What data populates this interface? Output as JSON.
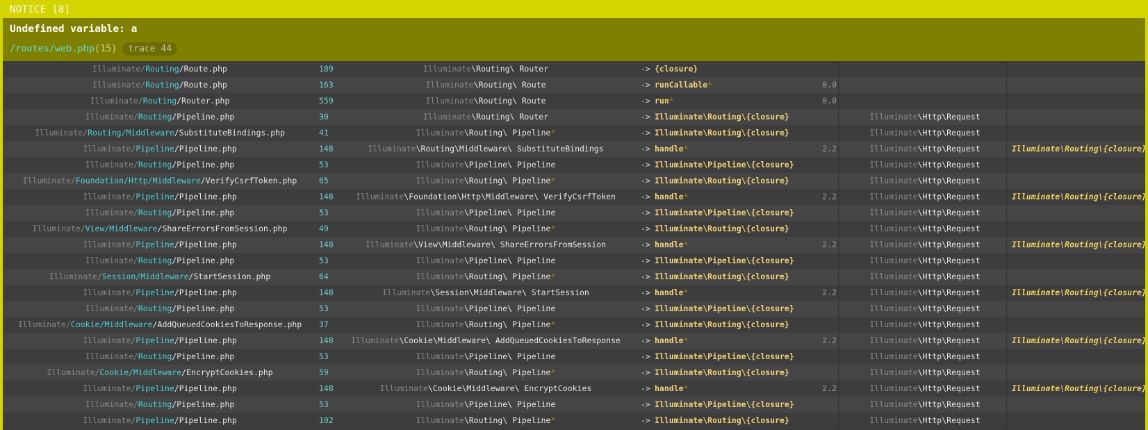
{
  "header": {
    "notice": "NOTICE [8]",
    "message": "Undefined variable: a",
    "file": "/routes/web.php",
    "line": "(15)",
    "trace_badge": "trace 44"
  },
  "rows": [
    {
      "fv": "Illuminate/",
      "fm": "Routing",
      "fe": "/Route.php",
      "line": "189",
      "cv": "Illuminate",
      "cw": "\\Routing\\ Router",
      "cs": "",
      "func": "{closure}",
      "fs": "",
      "time": "",
      "rv": "",
      "rw": "",
      "ret": ""
    },
    {
      "fv": "Illuminate/",
      "fm": "Routing",
      "fe": "/Route.php",
      "line": "163",
      "cv": "Illuminate",
      "cw": "\\Routing\\ Route",
      "cs": "",
      "func": "runCallable",
      "fs": "*",
      "time": "0.0",
      "rv": "",
      "rw": "",
      "ret": ""
    },
    {
      "fv": "Illuminate/",
      "fm": "Routing",
      "fe": "/Router.php",
      "line": "559",
      "cv": "Illuminate",
      "cw": "\\Routing\\ Route",
      "cs": "",
      "func": "run",
      "fs": "*",
      "time": "0.0",
      "rv": "",
      "rw": "",
      "ret": ""
    },
    {
      "fv": "Illuminate/",
      "fm": "Routing",
      "fe": "/Pipeline.php",
      "line": "30",
      "cv": "Illuminate",
      "cw": "\\Routing\\ Router",
      "cs": "",
      "func": "Illuminate\\Routing\\{closure}",
      "fs": "",
      "time": "",
      "rv": "Illuminate",
      "rw": "\\Http\\Request",
      "ret": ""
    },
    {
      "fv": "Illuminate/",
      "fm": "Routing/Middleware",
      "fe": "/SubstituteBindings.php",
      "line": "41",
      "cv": "Illuminate",
      "cw": "\\Routing\\ Pipeline",
      "cs": "*",
      "func": "Illuminate\\Routing\\{closure}",
      "fs": "",
      "time": "",
      "rv": "Illuminate",
      "rw": "\\Http\\Request",
      "ret": ""
    },
    {
      "fv": "Illuminate/",
      "fm": "Pipeline",
      "fe": "/Pipeline.php",
      "line": "148",
      "cv": "Illuminate",
      "cw": "\\Routing\\Middleware\\ SubstituteBindings",
      "cs": "",
      "func": "handle",
      "fs": "*",
      "time": "2.2",
      "rv": "Illuminate",
      "rw": "\\Http\\Request",
      "ret": "Illuminate\\Routing\\{closure}"
    },
    {
      "fv": "Illuminate/",
      "fm": "Routing",
      "fe": "/Pipeline.php",
      "line": "53",
      "cv": "Illuminate",
      "cw": "\\Pipeline\\ Pipeline",
      "cs": "",
      "func": "Illuminate\\Pipeline\\{closure}",
      "fs": "",
      "time": "",
      "rv": "Illuminate",
      "rw": "\\Http\\Request",
      "ret": ""
    },
    {
      "fv": "Illuminate/",
      "fm": "Foundation/Http/Middleware",
      "fe": "/VerifyCsrfToken.php",
      "line": "65",
      "cv": "Illuminate",
      "cw": "\\Routing\\ Pipeline",
      "cs": "*",
      "func": "Illuminate\\Routing\\{closure}",
      "fs": "",
      "time": "",
      "rv": "Illuminate",
      "rw": "\\Http\\Request",
      "ret": ""
    },
    {
      "fv": "Illuminate/",
      "fm": "Pipeline",
      "fe": "/Pipeline.php",
      "line": "148",
      "cv": "Illuminate",
      "cw": "\\Foundation\\Http\\Middleware\\ VerifyCsrfToken",
      "cs": "",
      "func": "handle",
      "fs": "*",
      "time": "2.2",
      "rv": "Illuminate",
      "rw": "\\Http\\Request",
      "ret": "Illuminate\\Routing\\{closure}"
    },
    {
      "fv": "Illuminate/",
      "fm": "Routing",
      "fe": "/Pipeline.php",
      "line": "53",
      "cv": "Illuminate",
      "cw": "\\Pipeline\\ Pipeline",
      "cs": "",
      "func": "Illuminate\\Pipeline\\{closure}",
      "fs": "",
      "time": "",
      "rv": "Illuminate",
      "rw": "\\Http\\Request",
      "ret": ""
    },
    {
      "fv": "Illuminate/",
      "fm": "View/Middleware",
      "fe": "/ShareErrorsFromSession.php",
      "line": "49",
      "cv": "Illuminate",
      "cw": "\\Routing\\ Pipeline",
      "cs": "*",
      "func": "Illuminate\\Routing\\{closure}",
      "fs": "",
      "time": "",
      "rv": "Illuminate",
      "rw": "\\Http\\Request",
      "ret": ""
    },
    {
      "fv": "Illuminate/",
      "fm": "Pipeline",
      "fe": "/Pipeline.php",
      "line": "148",
      "cv": "Illuminate",
      "cw": "\\View\\Middleware\\ ShareErrorsFromSession",
      "cs": "",
      "func": "handle",
      "fs": "*",
      "time": "2.2",
      "rv": "Illuminate",
      "rw": "\\Http\\Request",
      "ret": "Illuminate\\Routing\\{closure}"
    },
    {
      "fv": "Illuminate/",
      "fm": "Routing",
      "fe": "/Pipeline.php",
      "line": "53",
      "cv": "Illuminate",
      "cw": "\\Pipeline\\ Pipeline",
      "cs": "",
      "func": "Illuminate\\Pipeline\\{closure}",
      "fs": "",
      "time": "",
      "rv": "Illuminate",
      "rw": "\\Http\\Request",
      "ret": ""
    },
    {
      "fv": "Illuminate/",
      "fm": "Session/Middleware",
      "fe": "/StartSession.php",
      "line": "64",
      "cv": "Illuminate",
      "cw": "\\Routing\\ Pipeline",
      "cs": "*",
      "func": "Illuminate\\Routing\\{closure}",
      "fs": "",
      "time": "",
      "rv": "Illuminate",
      "rw": "\\Http\\Request",
      "ret": ""
    },
    {
      "fv": "Illuminate/",
      "fm": "Pipeline",
      "fe": "/Pipeline.php",
      "line": "148",
      "cv": "Illuminate",
      "cw": "\\Session\\Middleware\\ StartSession",
      "cs": "",
      "func": "handle",
      "fs": "*",
      "time": "2.2",
      "rv": "Illuminate",
      "rw": "\\Http\\Request",
      "ret": "Illuminate\\Routing\\{closure}"
    },
    {
      "fv": "Illuminate/",
      "fm": "Routing",
      "fe": "/Pipeline.php",
      "line": "53",
      "cv": "Illuminate",
      "cw": "\\Pipeline\\ Pipeline",
      "cs": "",
      "func": "Illuminate\\Pipeline\\{closure}",
      "fs": "",
      "time": "",
      "rv": "Illuminate",
      "rw": "\\Http\\Request",
      "ret": ""
    },
    {
      "fv": "Illuminate/",
      "fm": "Cookie/Middleware",
      "fe": "/AddQueuedCookiesToResponse.php",
      "line": "37",
      "cv": "Illuminate",
      "cw": "\\Routing\\ Pipeline",
      "cs": "*",
      "func": "Illuminate\\Routing\\{closure}",
      "fs": "",
      "time": "",
      "rv": "Illuminate",
      "rw": "\\Http\\Request",
      "ret": ""
    },
    {
      "fv": "Illuminate/",
      "fm": "Pipeline",
      "fe": "/Pipeline.php",
      "line": "148",
      "cv": "Illuminate",
      "cw": "\\Cookie\\Middleware\\ AddQueuedCookiesToResponse",
      "cs": "",
      "func": "handle",
      "fs": "*",
      "time": "2.2",
      "rv": "Illuminate",
      "rw": "\\Http\\Request",
      "ret": "Illuminate\\Routing\\{closure}"
    },
    {
      "fv": "Illuminate/",
      "fm": "Routing",
      "fe": "/Pipeline.php",
      "line": "53",
      "cv": "Illuminate",
      "cw": "\\Pipeline\\ Pipeline",
      "cs": "",
      "func": "Illuminate\\Pipeline\\{closure}",
      "fs": "",
      "time": "",
      "rv": "Illuminate",
      "rw": "\\Http\\Request",
      "ret": ""
    },
    {
      "fv": "Illuminate/",
      "fm": "Cookie/Middleware",
      "fe": "/EncryptCookies.php",
      "line": "59",
      "cv": "Illuminate",
      "cw": "\\Routing\\ Pipeline",
      "cs": "*",
      "func": "Illuminate\\Routing\\{closure}",
      "fs": "",
      "time": "",
      "rv": "Illuminate",
      "rw": "\\Http\\Request",
      "ret": ""
    },
    {
      "fv": "Illuminate/",
      "fm": "Pipeline",
      "fe": "/Pipeline.php",
      "line": "148",
      "cv": "Illuminate",
      "cw": "\\Cookie\\Middleware\\ EncryptCookies",
      "cs": "",
      "func": "handle",
      "fs": "*",
      "time": "2.2",
      "rv": "Illuminate",
      "rw": "\\Http\\Request",
      "ret": "Illuminate\\Routing\\{closure}"
    },
    {
      "fv": "Illuminate/",
      "fm": "Routing",
      "fe": "/Pipeline.php",
      "line": "53",
      "cv": "Illuminate",
      "cw": "\\Pipeline\\ Pipeline",
      "cs": "",
      "func": "Illuminate\\Pipeline\\{closure}",
      "fs": "",
      "time": "",
      "rv": "Illuminate",
      "rw": "\\Http\\Request",
      "ret": ""
    },
    {
      "fv": "Illuminate/",
      "fm": "Pipeline",
      "fe": "/Pipeline.php",
      "line": "102",
      "cv": "Illuminate",
      "cw": "\\Routing\\ Pipeline",
      "cs": "*",
      "func": "Illuminate\\Routing\\{closure}",
      "fs": "",
      "time": "",
      "rv": "Illuminate",
      "rw": "\\Http\\Request",
      "ret": ""
    }
  ]
}
